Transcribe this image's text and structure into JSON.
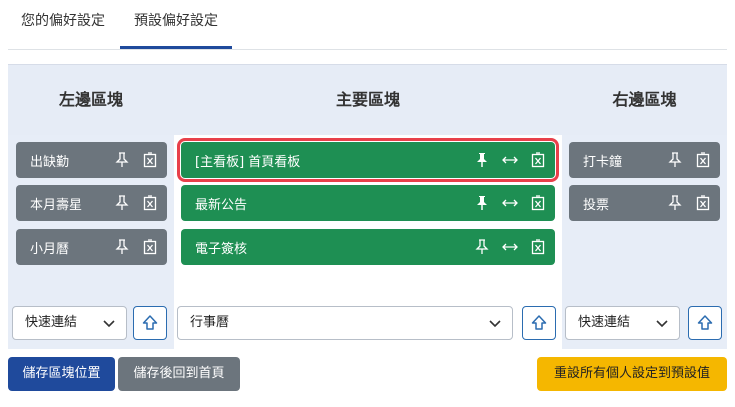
{
  "tabs": [
    {
      "label": "您的偏好設定"
    },
    {
      "label": "預設偏好設定"
    }
  ],
  "columns": {
    "left": {
      "title": "左邊區塊",
      "blocks": [
        {
          "label": "出缺勤"
        },
        {
          "label": "本月壽星"
        },
        {
          "label": "小月曆"
        }
      ],
      "select_value": "快速連結"
    },
    "main": {
      "title": "主要區塊",
      "blocks": [
        {
          "label": "[主看板] 首頁看板",
          "pinned": true,
          "highlighted": true
        },
        {
          "label": "最新公告",
          "pinned": true
        },
        {
          "label": "電子簽核",
          "pinned": false
        }
      ],
      "select_value": "行事曆"
    },
    "right": {
      "title": "右邊區塊",
      "blocks": [
        {
          "label": "打卡鐘"
        },
        {
          "label": "投票"
        }
      ],
      "select_value": "快速連結"
    }
  },
  "buttons": {
    "save_position": "儲存區塊位置",
    "save_return": "儲存後回到首頁",
    "reset_all": "重設所有個人設定到預設值"
  },
  "icons": {
    "pin": "pin-icon",
    "resize": "resize-horizontal-icon",
    "delete": "delete-icon",
    "chevron": "chevron-down-icon",
    "up": "arrow-up-icon"
  },
  "colors": {
    "primary": "#1f4a9c",
    "gray_block": "#6c757d",
    "green_block": "#1e8f53",
    "highlight": "#e8404a",
    "warning": "#f5b700",
    "header_bg": "#e6ecf6"
  }
}
